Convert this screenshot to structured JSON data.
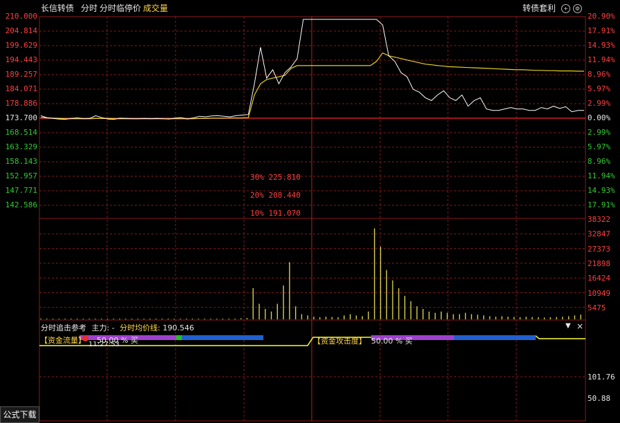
{
  "header": {
    "name": "长信转债",
    "tab_intraday": "分时",
    "tab_limit": "分时临停价",
    "tab_volume": "成交量",
    "arbitrage": "转债套利",
    "plus_icon": "plus-icon",
    "settings_icon": "settings-icon"
  },
  "price_axis_left": [
    "210.000",
    "204.814",
    "199.629",
    "194.443",
    "189.257",
    "184.071",
    "178.886",
    "173.700",
    "168.514",
    "163.329",
    "158.143",
    "152.957",
    "147.771",
    "142.586"
  ],
  "pct_axis_right": [
    "20.90%",
    "17.91%",
    "14.93%",
    "11.94%",
    "8.96%",
    "5.97%",
    "2.99%",
    "0.00%",
    "2.99%",
    "5.97%",
    "8.96%",
    "11.94%",
    "14.93%",
    "17.91%"
  ],
  "limit_prices": [
    {
      "pct": "30%",
      "price": "225.810"
    },
    {
      "pct": "20%",
      "price": "208.440"
    },
    {
      "pct": "10%",
      "price": "191.070"
    }
  ],
  "volume_axis": [
    "38322",
    "32847",
    "27373",
    "21898",
    "16424",
    "10949",
    "5475"
  ],
  "indicator_panel": {
    "title": "分时追击参考",
    "main_label": "主力: -",
    "avg_label": "分时均价线:",
    "avg_value": "190.546",
    "dropdown_icon": "chevron-down-icon",
    "close_icon": "close-icon",
    "money_flow_label": "【资金流量】",
    "money_flow_value": "50.00 % 买",
    "money_flow_time": "11:27:53",
    "attack_label": "【资金攻击度】",
    "attack_value": "50.00 % 买"
  },
  "lower_axis": [
    "101.76",
    "50.88"
  ],
  "formula_button": "公式下载",
  "colors": {
    "grid": "#8b1a1a",
    "price_line": "#ffffff",
    "avg_line": "#e8d020",
    "volume_bar": "#d8d050",
    "flow_line": "#ffff30"
  },
  "chart_data": {
    "type": "line",
    "title": "",
    "ylabel": "",
    "ylim": [
      142.586,
      210.0
    ],
    "prev_close": 173.7,
    "series": [
      {
        "values": [
          174.6,
          173.9,
          173.6,
          173.4,
          173.3,
          173.6,
          173.8,
          173.5,
          173.6,
          174.6,
          173.9,
          173.4,
          173.3,
          173.7,
          173.6,
          173.5,
          173.5,
          173.6,
          173.5,
          173.6,
          173.5,
          173.4,
          173.7,
          173.9,
          173.4,
          173.8,
          174.4,
          174.2,
          174.5,
          174.6,
          174.4,
          174.2,
          174.6,
          174.8,
          175.0,
          186.0,
          199.0,
          188.0,
          191.0,
          186.0,
          190.0,
          192.0,
          195.0,
          209.0,
          209.0,
          209.0,
          209.0,
          209.0,
          209.0,
          209.0,
          209.0,
          209.0,
          209.0,
          209.0,
          209.0,
          209.0,
          207.0,
          196.0,
          194.0,
          190.0,
          188.5,
          184.0,
          183.0,
          181.0,
          180.0,
          182.0,
          183.5,
          181.0,
          180.0,
          182.0,
          178.0,
          180.0,
          181.0,
          177.0,
          176.5,
          176.5,
          177.0,
          177.5,
          177.0,
          177.0,
          176.5,
          176.5,
          177.5,
          177.0,
          178.0,
          177.2,
          177.8,
          176.0,
          176.5,
          176.5
        ]
      },
      {
        "values": [
          174.0,
          173.8,
          173.7,
          173.6,
          173.5,
          173.5,
          173.5,
          173.5,
          173.5,
          173.6,
          173.6,
          173.6,
          173.5,
          173.5,
          173.5,
          173.5,
          173.5,
          173.5,
          173.5,
          173.5,
          173.5,
          173.5,
          173.5,
          173.5,
          173.5,
          173.5,
          173.6,
          173.6,
          173.7,
          173.7,
          173.7,
          173.8,
          173.8,
          173.8,
          173.9,
          182.0,
          186.0,
          187.5,
          188.0,
          188.5,
          189.0,
          191.5,
          192.5,
          192.5,
          192.5,
          192.5,
          192.5,
          192.5,
          192.5,
          192.5,
          192.5,
          192.5,
          192.5,
          192.5,
          192.5,
          194.0,
          197.0,
          196.0,
          195.5,
          195.0,
          194.5,
          194.0,
          193.5,
          193.0,
          192.8,
          192.5,
          192.3,
          192.1,
          192.0,
          191.9,
          191.8,
          191.7,
          191.6,
          191.5,
          191.4,
          191.3,
          191.2,
          191.1,
          191.0,
          191.0,
          190.9,
          190.8,
          190.8,
          190.7,
          190.7,
          190.6,
          190.6,
          190.6,
          190.5,
          190.5
        ]
      }
    ],
    "volume": [
      300,
      200,
      150,
      100,
      200,
      150,
      100,
      150,
      120,
      100,
      100,
      100,
      100,
      100,
      100,
      100,
      100,
      100,
      100,
      100,
      100,
      100,
      100,
      100,
      100,
      100,
      150,
      100,
      200,
      200,
      200,
      300,
      300,
      400,
      500,
      12000,
      6000,
      4000,
      3000,
      6000,
      13000,
      22000,
      5000,
      2000,
      1500,
      1000,
      800,
      1000,
      900,
      800,
      1500,
      2000,
      1500,
      1200,
      3000,
      35000,
      28000,
      19000,
      15000,
      12000,
      9000,
      7000,
      5000,
      4000,
      3000,
      2500,
      3000,
      2500,
      2000,
      2000,
      2500,
      2000,
      1800,
      1500,
      1200,
      1000,
      1200,
      1000,
      900,
      800,
      1000,
      900,
      800,
      700,
      800,
      900,
      1000,
      1200,
      1500,
      1800
    ],
    "volume_ylim": [
      0,
      38322
    ]
  }
}
